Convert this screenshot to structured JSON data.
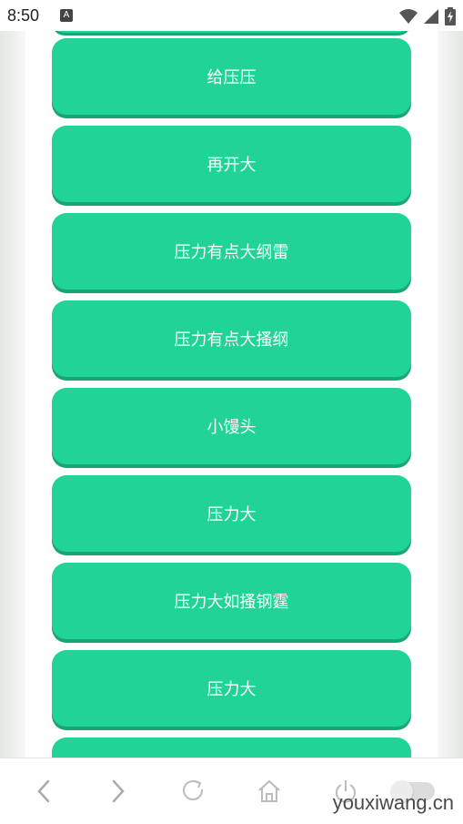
{
  "status_bar": {
    "time": "8:50",
    "notification_icon_letter": "A",
    "icons": [
      "wifi-icon",
      "signal-icon",
      "battery-charging-icon"
    ]
  },
  "buttons": [
    {
      "label": "给压压"
    },
    {
      "label": "再开大"
    },
    {
      "label": "压力有点大纲雷"
    },
    {
      "label": "压力有点大搔纲"
    },
    {
      "label": "小馒头"
    },
    {
      "label": "压力大"
    },
    {
      "label": "压力大如搔钢霆"
    },
    {
      "label": "压力大"
    },
    {
      "label": ""
    }
  ],
  "bottom_bar": {
    "watermark": "youxiwang.cn",
    "controls": [
      "back-icon",
      "forward-icon",
      "refresh-icon",
      "home-icon",
      "power-icon",
      "toggle"
    ]
  },
  "colors": {
    "button": "#21d396",
    "button_shadow": "#19a576",
    "button_text": "#ffffff",
    "background": "#ffffff"
  }
}
